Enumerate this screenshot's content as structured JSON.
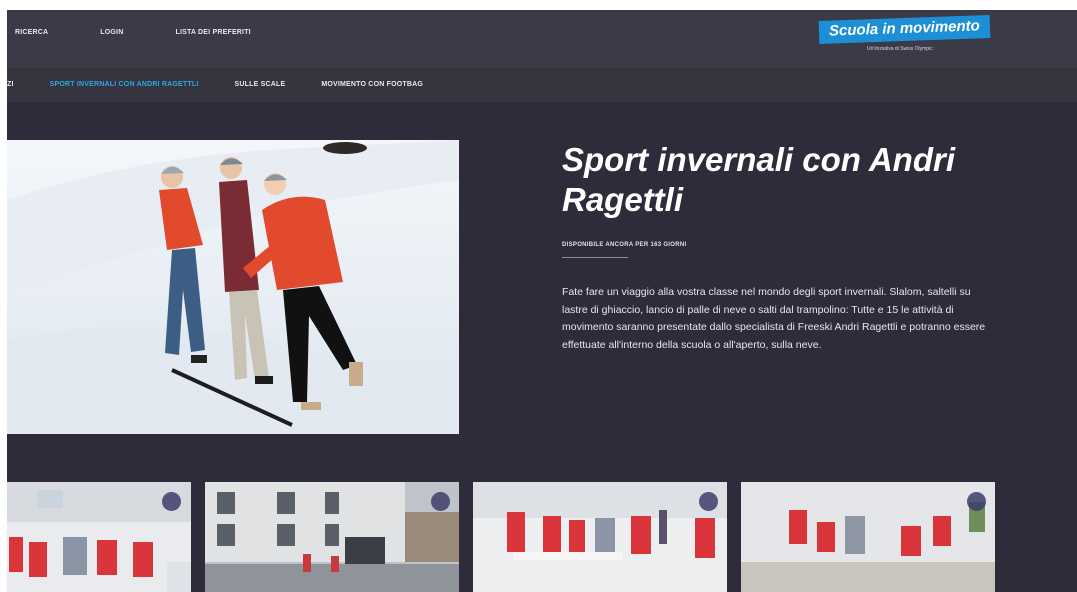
{
  "topnav": {
    "search": "RICERCA",
    "login": "LOGIN",
    "favorites": "LISTA DEI PREFERITI"
  },
  "logo": {
    "badge": "Scuola in movimento",
    "sub": "Un'iniziativa di Swiss Olympic"
  },
  "subnav": {
    "items": [
      "ZI",
      "SPORT INVERNALI CON ANDRI RAGETTLI",
      "SULLE SCALE",
      "MOVIMENTO CON FOOTBAG"
    ],
    "active_index": 1
  },
  "hero": {
    "title": "Sport invernali con Andri Ragettli",
    "availability": "DISPONIBILE ANCORA PER 163 GIORNI",
    "description": "Fate fare un viaggio alla vostra classe nel mondo degli sport invernali. Slalom, saltelli su lastre di ghiaccio, lancio di palle di neve o salti dal trampolino: Tutte e 15 le attività di movimento saranno presentate dallo specialista di Freeski Andri Ragettli e potranno essere effettuate all'interno della scuola o all'aperto, sulla neve."
  },
  "colors": {
    "background": "#2e2c3a",
    "topbar": "#3b3a47",
    "accent": "#2fa6e6",
    "logo_blue": "#1d8fd6",
    "jacket_red": "#e24a2e"
  },
  "cards": [
    {
      "icon": "heart-icon"
    },
    {
      "icon": "heart-icon"
    },
    {
      "icon": "heart-icon"
    },
    {
      "icon": "heart-icon"
    }
  ]
}
